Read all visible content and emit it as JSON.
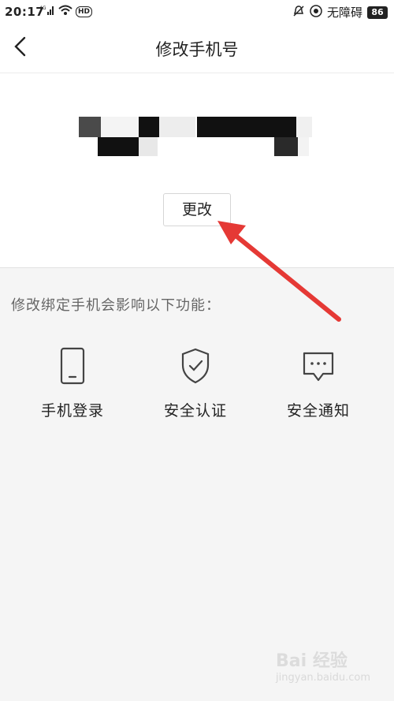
{
  "status_bar": {
    "time": "20:17",
    "network": "4G",
    "hd": "HD",
    "accessibility_text": "无障碍",
    "battery": "86"
  },
  "nav": {
    "title": "修改手机号",
    "back_icon": "chevron-left-icon"
  },
  "phone_section": {
    "masked_phone_icon": "blurred-mosaic",
    "change_button_label": "更改"
  },
  "features_section": {
    "label": "修改绑定手机会影响以下功能：",
    "items": [
      {
        "icon": "phone-icon",
        "label": "手机登录"
      },
      {
        "icon": "shield-check-icon",
        "label": "安全认证"
      },
      {
        "icon": "message-icon",
        "label": "安全通知"
      }
    ]
  },
  "watermark": {
    "brand": "Bai 经验",
    "url": "jingyan.baidu.com"
  },
  "colors": {
    "arrow": "#e53935",
    "page_bg": "#f5f5f5"
  }
}
